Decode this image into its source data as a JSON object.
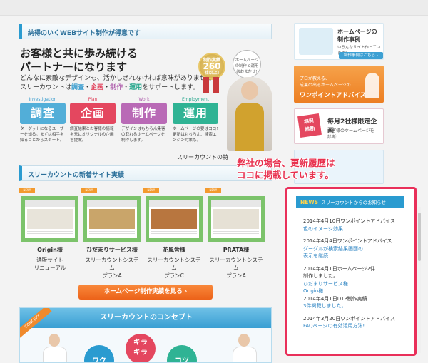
{
  "colors": {
    "accent": "#2a9bd0",
    "highlight": "#e9305a",
    "cta": "#ec6219"
  },
  "section_title_top": "納得のいくWEBサイト制作が得意です",
  "hero": {
    "heading_line1": "お客様と共に歩み続ける",
    "heading_line2": "パートナーになります",
    "para1": "どんなに素敵なデザインも、活かしきれなければ意味がありません。",
    "para2_prefix": "スリーカウントは",
    "kw1": "調査",
    "kw2": "企画",
    "kw3": "制作",
    "kw4": "運用",
    "para2_suffix": "をサポートします。",
    "badge_label": "制作実績",
    "badge_num": "260",
    "badge_unit": "社以上!",
    "bubble_text": "ホームページの制作と運用はおまかせ!"
  },
  "steps": [
    {
      "en": "Investigation",
      "label": "調査",
      "color": "#52aed8",
      "desc": "ターゲットになるユーザーを知る。まずは相手を知ることからスタート。"
    },
    {
      "en": "Plan",
      "label": "企画",
      "color": "#e4475f",
      "desc": "調査結果とお客様の情報を元にオリジナルの企画を提案。"
    },
    {
      "en": "Work",
      "label": "制作",
      "color": "#b96ab6",
      "desc": "デザインはもちろん集客の取れるホームページを制作します。"
    },
    {
      "en": "Employment",
      "label": "運用",
      "color": "#2fb394",
      "desc": "ホームページの要はココ!更新はもちろん、検索エンジン対策も。"
    }
  ],
  "steps_footer": "スリーカウントの特",
  "section_title_works": "スリーカウントの新着サイト実績",
  "works": [
    {
      "tag": "NEW!",
      "name": "Origin様",
      "sub1": "通販サイト",
      "sub2": "リニューアル",
      "img": "#e8e4da"
    },
    {
      "tag": "NEW!",
      "name": "ひだまりサービス様",
      "sub1": "スリーカウントシステム",
      "sub2": "プランA",
      "img": "#c9a56a"
    },
    {
      "tag": "NEW!",
      "name": "花風舎様",
      "sub1": "スリーカウントシステム",
      "sub2": "プランC",
      "img": "#b8763f"
    },
    {
      "tag": "NEW!",
      "name": "PRATA様",
      "sub1": "スリーカウントシステム",
      "sub2": "プランA",
      "img": "#e6e1d5"
    }
  ],
  "cta_label": "ホームページ制作実績を見る ›",
  "concept": {
    "ribbon": "CONCEPT",
    "title": "スリーカウントのコンセプト",
    "c1": "ワク",
    "c2a": "キラ",
    "c2b": "キラ",
    "c3": "コツ"
  },
  "side": {
    "portfolio_title1": "ホームページの",
    "portfolio_title2": "制作事例",
    "portfolio_sub": "いろんなサイト作っています!",
    "portfolio_btn": "制作事例はこちら ›",
    "advice_line1": "プロが教える、",
    "advice_line2": "成果の出るホームページの",
    "advice_title": "ワンポイントアドバイス",
    "free_stamp1": "無料",
    "free_stamp2": "診断",
    "free_title": "毎月2社様限定企画",
    "free_sub1": "お客様のホームページを",
    "free_sub2": "診断!"
  },
  "annotation": {
    "line1": "弊社の場合、更新履歴は",
    "line2": "ココに掲載しています。"
  },
  "news": {
    "head_label": "NEWS",
    "head_title": "スリーカウントからのお知らせ",
    "items": [
      {
        "date": "2014年4月10日ワンポイントアドバイス",
        "l1": "色のイメージ効果",
        "l2": ""
      },
      {
        "date": "2014年4月4日ワンポイントアドバイス",
        "l1": "グーグルが検索結果画面の",
        "l2": "表示を継続"
      },
      {
        "date": "2014年4月1日ホームページ2件",
        "l1": "制作しました。",
        "l2": "ひだまりサービス様"
      },
      {
        "date": "Origin様",
        "l1": "2014年4月1日DTP制作実績",
        "l2": "3件掲載しました。"
      },
      {
        "date": "2014年3月20日ワンポイントアドバイス",
        "l1": "FAQページの有効活用方法!",
        "l2": ""
      }
    ]
  }
}
